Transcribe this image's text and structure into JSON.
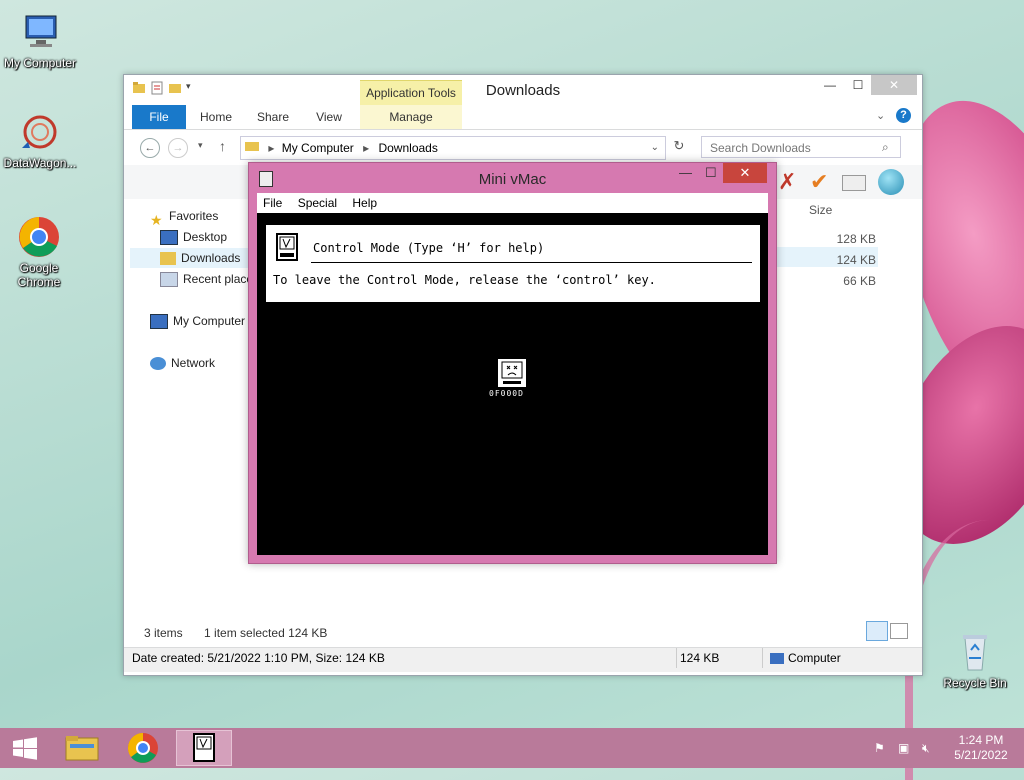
{
  "desktop": {
    "icons": [
      {
        "label": "My Computer"
      },
      {
        "label": "DataWagon..."
      },
      {
        "label": "Google Chrome"
      },
      {
        "label": "Recycle Bin"
      }
    ]
  },
  "explorer": {
    "title": "Downloads",
    "context_tab": "Application Tools",
    "tabs": [
      "File",
      "Home",
      "Share",
      "View",
      "Manage"
    ],
    "breadcrumb": [
      "My Computer",
      "Downloads"
    ],
    "search_placeholder": "Search Downloads",
    "column_size": "Size",
    "nav": {
      "favorites": "Favorites",
      "desktop": "Desktop",
      "downloads": "Downloads",
      "recent": "Recent places",
      "computer": "My Computer",
      "network": "Network"
    },
    "sizes": [
      "128 KB",
      "124 KB",
      "66 KB"
    ],
    "status": {
      "items": "3 items",
      "selected": "1 item selected  124 KB"
    },
    "details": {
      "created": "Date created: 5/21/2022 1:10 PM, Size: 124 KB",
      "size": "124 KB",
      "location": "Computer"
    }
  },
  "vmac": {
    "title": "Mini vMac",
    "menu": [
      "File",
      "Special",
      "Help"
    ],
    "control_title": "Control Mode (Type ‘H’ for help)",
    "control_msg": "To leave the Control Mode, release the ‘control’ key.",
    "error_code": "0F000D"
  },
  "taskbar": {
    "time": "1:24 PM",
    "date": "5/21/2022"
  }
}
